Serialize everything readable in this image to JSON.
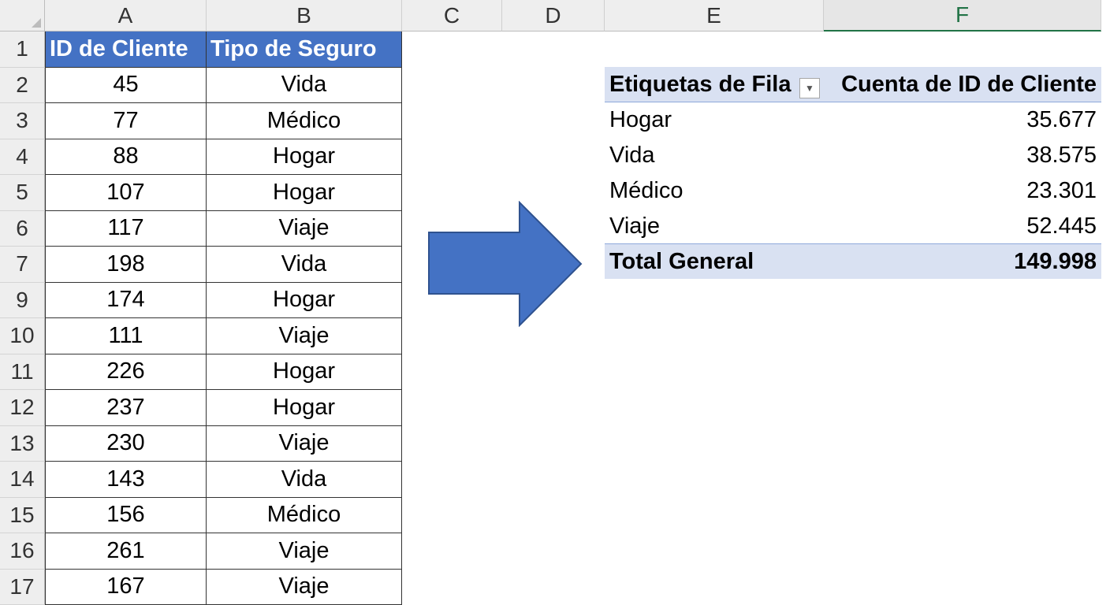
{
  "columns": [
    "A",
    "B",
    "C",
    "D",
    "E",
    "F"
  ],
  "active_column": "F",
  "source_table": {
    "headers": [
      "ID de Cliente",
      "Tipo de Seguro"
    ],
    "rows": [
      {
        "row": "1",
        "id": "",
        "tipo": ""
      },
      {
        "row": "2",
        "id": "45",
        "tipo": "Vida"
      },
      {
        "row": "3",
        "id": "77",
        "tipo": "Médico"
      },
      {
        "row": "4",
        "id": "88",
        "tipo": "Hogar"
      },
      {
        "row": "5",
        "id": "107",
        "tipo": "Hogar"
      },
      {
        "row": "6",
        "id": "117",
        "tipo": "Viaje"
      },
      {
        "row": "7",
        "id": "198",
        "tipo": "Vida"
      },
      {
        "row": "9",
        "id": "174",
        "tipo": "Hogar"
      },
      {
        "row": "10",
        "id": "111",
        "tipo": "Viaje"
      },
      {
        "row": "11",
        "id": "226",
        "tipo": "Hogar"
      },
      {
        "row": "12",
        "id": "237",
        "tipo": "Hogar"
      },
      {
        "row": "13",
        "id": "230",
        "tipo": "Viaje"
      },
      {
        "row": "14",
        "id": "143",
        "tipo": "Vida"
      },
      {
        "row": "15",
        "id": "156",
        "tipo": "Médico"
      },
      {
        "row": "16",
        "id": "261",
        "tipo": "Viaje"
      },
      {
        "row": "17",
        "id": "167",
        "tipo": "Viaje"
      }
    ]
  },
  "arrow": {
    "icon": "right-arrow-icon",
    "color": "#4472c4"
  },
  "pivot": {
    "row_label_header": "Etiquetas de Fila",
    "value_header": "Cuenta de ID de Cliente",
    "filter_icon": "filter-dropdown-icon",
    "rows": [
      {
        "label": "Hogar",
        "value": "35.677"
      },
      {
        "label": "Vida",
        "value": "38.575"
      },
      {
        "label": "Médico",
        "value": "23.301"
      },
      {
        "label": "Viaje",
        "value": "52.445"
      }
    ],
    "total_label": "Total General",
    "total_value": "149.998"
  },
  "colors": {
    "header_blue": "#4472c4",
    "pivot_band": "#d9e1f2",
    "active_green": "#217346"
  }
}
